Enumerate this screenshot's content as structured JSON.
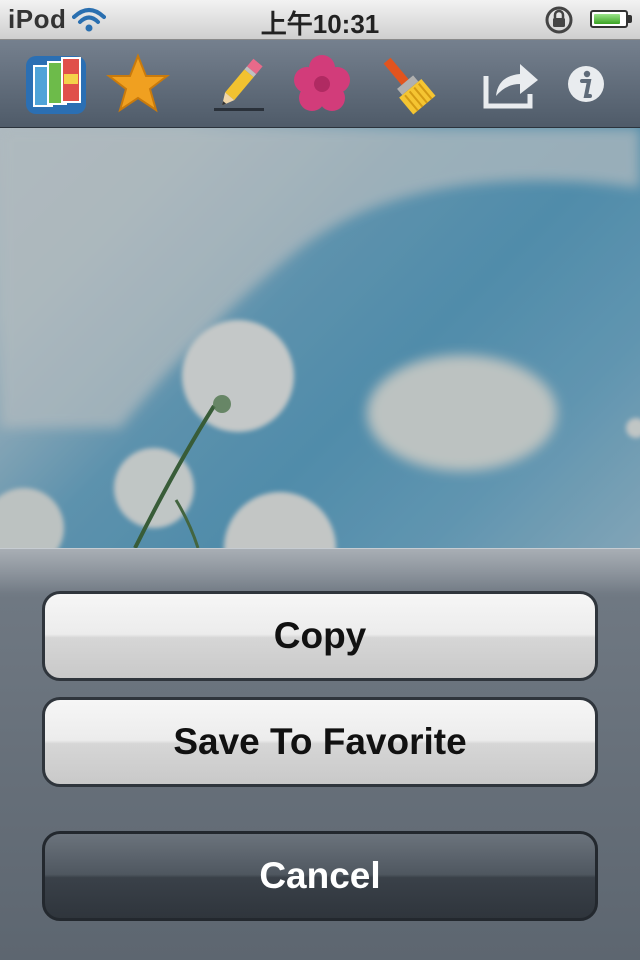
{
  "status_bar": {
    "carrier": "iPod",
    "time": "上午10:31",
    "battery_level": 0.85
  },
  "toolbar": {
    "icons": [
      "gallery-icon",
      "star-icon",
      "pencil-icon",
      "flower-icon",
      "brush-icon",
      "share-icon",
      "info-icon"
    ]
  },
  "action_sheet": {
    "buttons": [
      {
        "label": "Copy"
      },
      {
        "label": "Save To Favorite"
      },
      {
        "label": "Cancel"
      }
    ]
  },
  "colors": {
    "toolbar": "#5f6b79",
    "sheet": "#6f7882",
    "cancel": "#3a4149",
    "star": "#f0a020",
    "flower": "#d23c7a"
  }
}
